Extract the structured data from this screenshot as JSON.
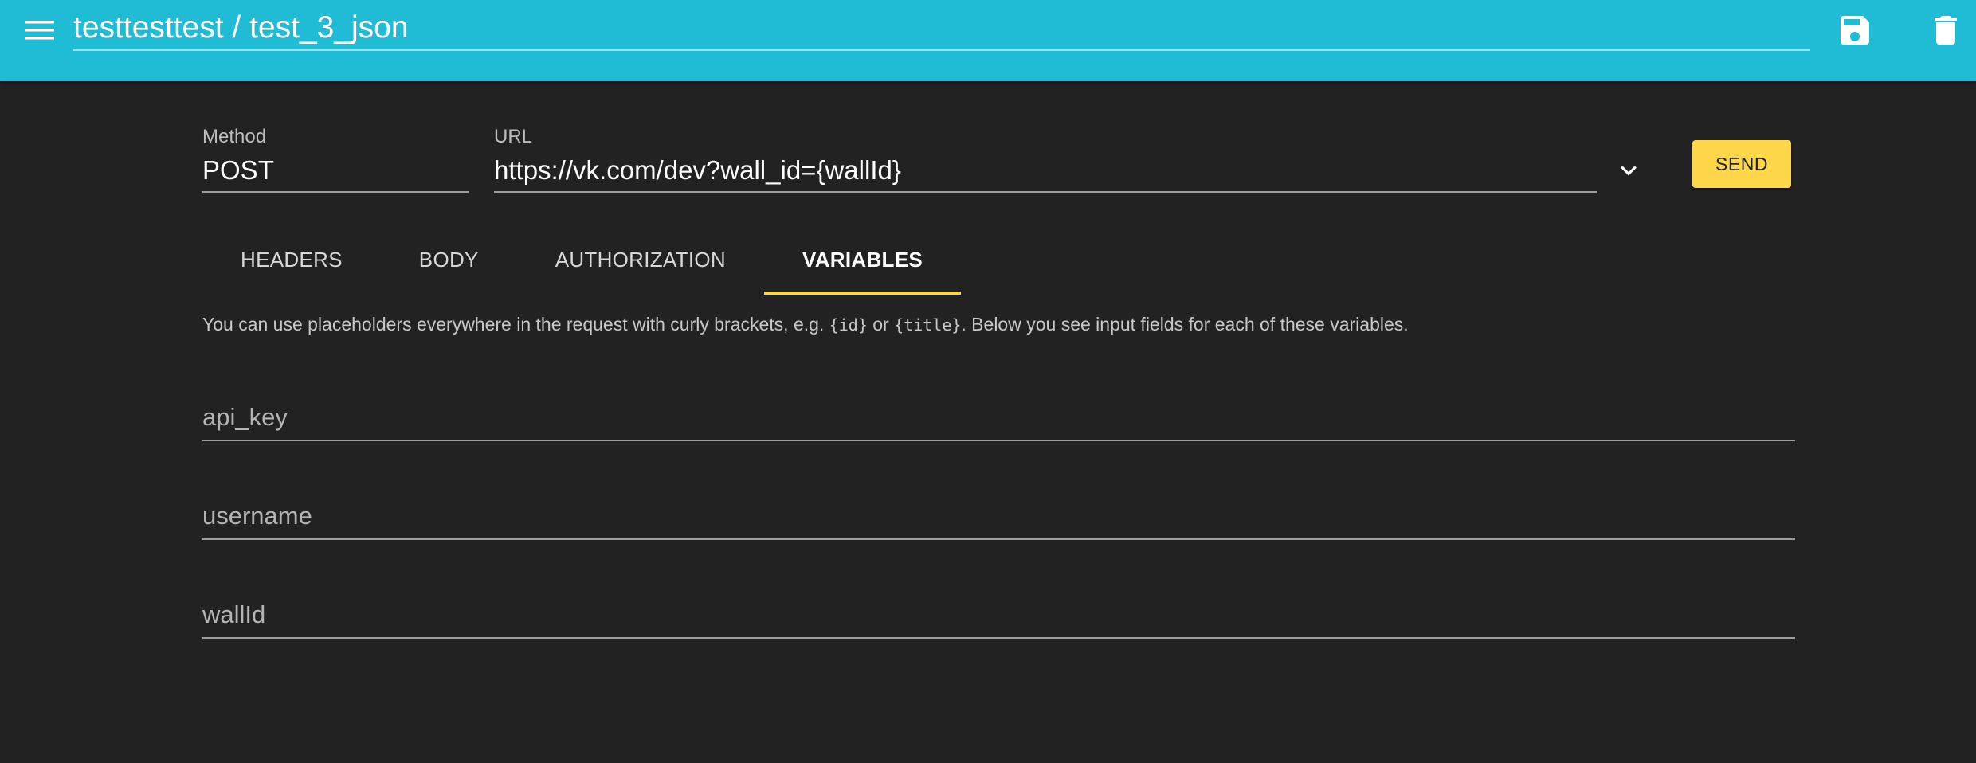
{
  "appbar": {
    "menu_icon": "menu-icon",
    "title": "testtesttest / test_3_json",
    "save_icon": "save-icon",
    "delete_icon": "delete-icon",
    "color": "#20bcd5"
  },
  "request": {
    "method_label": "Method",
    "method_value": "POST",
    "url_label": "URL",
    "url_value": "https://vk.com/dev?wall_id={wallId}",
    "dropdown_icon": "chevron-down-icon",
    "send_label": "SEND",
    "send_color": "#fdd649"
  },
  "tabs": [
    {
      "label": "HEADERS",
      "active": false
    },
    {
      "label": "BODY",
      "active": false
    },
    {
      "label": "AUTHORIZATION",
      "active": false
    },
    {
      "label": "VARIABLES",
      "active": true
    }
  ],
  "variables": {
    "help_prefix": "You can use placeholders everywhere in the request with curly brackets, e.g. ",
    "help_code_1": "{id}",
    "help_or": " or ",
    "help_code_2": "{title}",
    "help_suffix": ". Below you see input fields for each of these variables.",
    "fields": [
      {
        "placeholder": "api_key",
        "value": ""
      },
      {
        "placeholder": "username",
        "value": ""
      },
      {
        "placeholder": "wallId",
        "value": ""
      }
    ]
  }
}
